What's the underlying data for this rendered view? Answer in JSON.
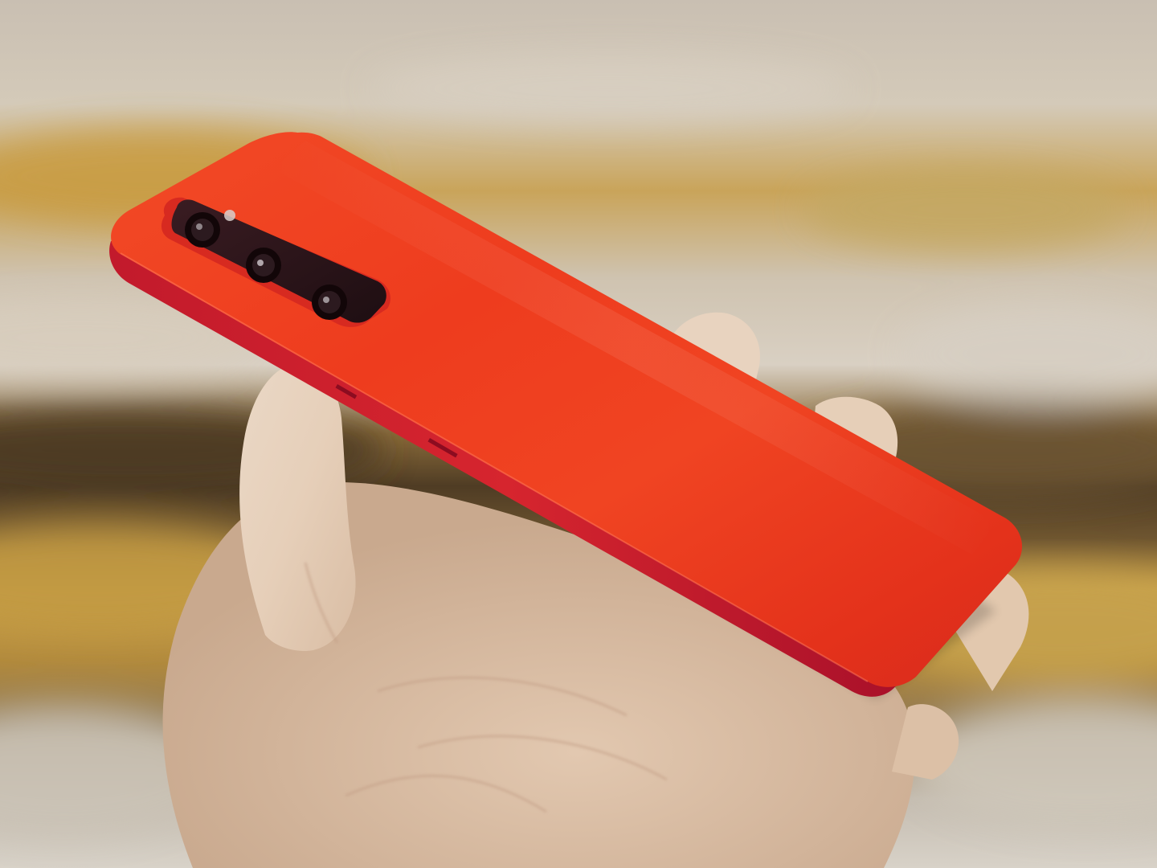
{
  "scene": {
    "subject": "smartphone",
    "colors": {
      "phone_body": "#ee3a1e",
      "phone_edge": "#b8152a",
      "camera_module": "#2a1418",
      "skin": "#e6cdb6",
      "background_wood_light": "#cfc6b8",
      "background_wood_dark": "#5a4630",
      "background_wood_yellow": "#c9a14a"
    }
  }
}
